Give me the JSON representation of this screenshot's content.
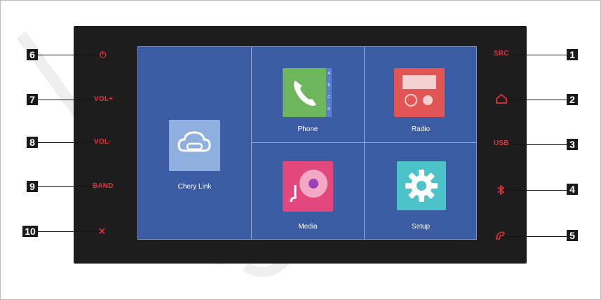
{
  "screen": {
    "apps": {
      "cherylink": {
        "label": "Chery Link",
        "icon": "cloud-link-icon"
      },
      "phone": {
        "label": "Phone",
        "icon": "phone-icon",
        "side_letters": [
          "A",
          "B",
          "C",
          "D"
        ]
      },
      "radio": {
        "label": "Radio",
        "icon": "radio-icon"
      },
      "media": {
        "label": "Media",
        "icon": "music-disc-icon"
      },
      "setup": {
        "label": "Setup",
        "icon": "gear-icon"
      }
    }
  },
  "left_buttons": [
    {
      "number": "6",
      "label": "⏻",
      "icon": "power-icon"
    },
    {
      "number": "7",
      "label": "VOL+"
    },
    {
      "number": "8",
      "label": "VOL-"
    },
    {
      "number": "9",
      "label": "BAND"
    },
    {
      "number": "10",
      "label": "⨯",
      "icon": "mute-icon"
    }
  ],
  "right_buttons": [
    {
      "number": "1",
      "label": "SRC"
    },
    {
      "number": "2",
      "label": "",
      "icon": "home-icon"
    },
    {
      "number": "3",
      "label": "USB"
    },
    {
      "number": "4",
      "label": "",
      "icon": "bluetooth-icon"
    },
    {
      "number": "5",
      "label": "",
      "icon": "hang-up-icon"
    }
  ],
  "colors": {
    "label_red": "#e3313a",
    "screen_blue": "#3b5ba3",
    "phone_green": "#6db65b",
    "radio_red": "#e25555",
    "media_pink": "#e2487c",
    "setup_teal": "#4bc3c9",
    "cherylink_tile": "#8fb0df"
  }
}
